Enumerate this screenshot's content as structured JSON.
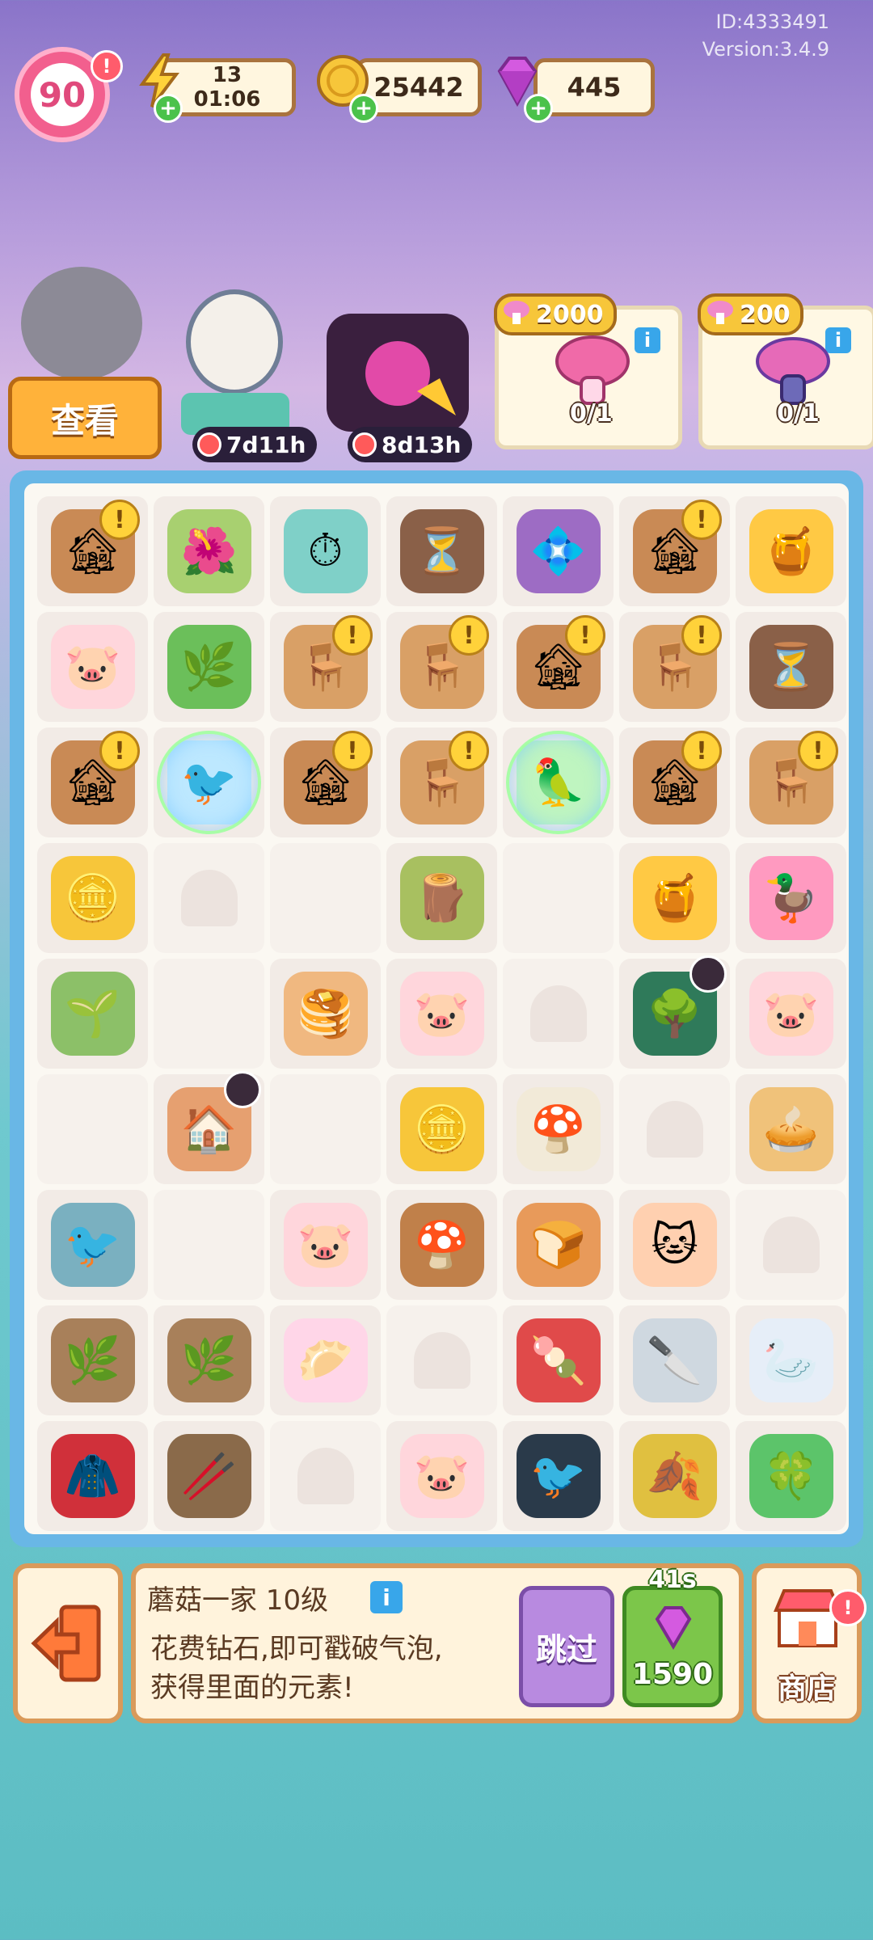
{
  "meta": {
    "player_id": "ID:4333491",
    "version": "Version:3.4.9"
  },
  "player": {
    "level": "90"
  },
  "resources": {
    "energy": {
      "value": "13",
      "timer": "01:06"
    },
    "coins": {
      "value": "25442"
    },
    "gems": {
      "value": "445"
    }
  },
  "characters": {
    "look_button": "查看",
    "timer1": "7d11h",
    "timer2": "8d13h"
  },
  "orders": [
    {
      "price": "2000",
      "progress": "0/1"
    },
    {
      "price": "200",
      "progress": "0/1"
    }
  ],
  "board": {
    "rows": [
      [
        {
          "i": "fireplace",
          "e": "🏚",
          "a": 1
        },
        {
          "i": "pansy-vine",
          "e": "🌺"
        },
        {
          "i": "stopwatch",
          "e": "⏱"
        },
        {
          "i": "hourglass",
          "e": "⏳"
        },
        {
          "i": "gem-frame",
          "e": "💠"
        },
        {
          "i": "fireplace",
          "e": "🏚",
          "a": 1
        },
        {
          "i": "honey-gourd",
          "e": "🍯"
        }
      ],
      [
        {
          "i": "pig-plush",
          "e": "🐷"
        },
        {
          "i": "green-bush",
          "e": "🌿"
        },
        {
          "i": "bear-chair",
          "e": "🪑",
          "a": 1
        },
        {
          "i": "bear-chair",
          "e": "🪑",
          "a": 1
        },
        {
          "i": "fireplace",
          "e": "🏚",
          "a": 1
        },
        {
          "i": "bear-chair",
          "e": "🪑",
          "a": 1
        },
        {
          "i": "hourglass",
          "e": "⏳"
        }
      ],
      [
        {
          "i": "fireplace",
          "e": "🏚",
          "a": 1
        },
        {
          "i": "pigeon-bubble",
          "e": "🐦",
          "b": 1
        },
        {
          "i": "fireplace",
          "e": "🏚",
          "a": 1
        },
        {
          "i": "bear-chair",
          "e": "🪑",
          "a": 1
        },
        {
          "i": "bird-bubble",
          "e": "🦜",
          "b": 1
        },
        {
          "i": "fireplace",
          "e": "🏚",
          "a": 1
        },
        {
          "i": "bear-chair",
          "e": "🪑",
          "a": 1
        }
      ],
      [
        {
          "i": "coin-pile",
          "e": "🪙"
        },
        {
          "i": "empty",
          "p": 1
        },
        {
          "i": "empty"
        },
        {
          "i": "mossy-log",
          "e": "🪵"
        },
        {
          "i": "empty"
        },
        {
          "i": "honey-gourd",
          "e": "🍯"
        },
        {
          "i": "duck-dress",
          "e": "🦆"
        }
      ],
      [
        {
          "i": "vine-branch",
          "e": "🌱"
        },
        {
          "i": "empty"
        },
        {
          "i": "pancake-stack",
          "e": "🥞"
        },
        {
          "i": "pig-plush",
          "e": "🐷"
        },
        {
          "i": "empty",
          "p": 1
        },
        {
          "i": "dark-tree",
          "e": "🌳",
          "l": 1
        },
        {
          "i": "pig-plush",
          "e": "🐷"
        }
      ],
      [
        {
          "i": "empty"
        },
        {
          "i": "gingerbread-house",
          "e": "🏠",
          "l": 1
        },
        {
          "i": "empty"
        },
        {
          "i": "coin",
          "e": "🪙"
        },
        {
          "i": "white-mushroom",
          "e": "🍄"
        },
        {
          "i": "empty",
          "p": 1
        },
        {
          "i": "pie",
          "e": "🥧"
        }
      ],
      [
        {
          "i": "pigeon",
          "e": "🐦"
        },
        {
          "i": "empty"
        },
        {
          "i": "pig-pair",
          "e": "🐷"
        },
        {
          "i": "brown-mushroom",
          "e": "🍄"
        },
        {
          "i": "jam-toast",
          "e": "🍞"
        },
        {
          "i": "pig-cat-group",
          "e": "🐱"
        },
        {
          "i": "empty",
          "p": 1
        }
      ],
      [
        {
          "i": "sparkle-branches",
          "e": "🌿"
        },
        {
          "i": "sparkle-branches",
          "e": "🌿"
        },
        {
          "i": "bun",
          "e": "🥟"
        },
        {
          "i": "empty",
          "p": 1
        },
        {
          "i": "candied-fruit",
          "e": "🍡"
        },
        {
          "i": "pizza-cutter",
          "e": "🔪"
        },
        {
          "i": "swan",
          "e": "🦢"
        }
      ],
      [
        {
          "i": "red-hood",
          "e": "🧥"
        },
        {
          "i": "twig",
          "e": "🥢"
        },
        {
          "i": "empty",
          "p": 1
        },
        {
          "i": "pig-pair",
          "e": "🐷"
        },
        {
          "i": "crow",
          "e": "🐦"
        },
        {
          "i": "autumn-leaf",
          "e": "🍂"
        },
        {
          "i": "clover",
          "e": "🍀"
        }
      ]
    ]
  },
  "info_panel": {
    "title": "蘑菇一家 10级",
    "description_line1": "花费钻石,即可戳破气泡,",
    "description_line2": "获得里面的元素!",
    "skip_label": "跳过",
    "timer": "41s",
    "gem_cost": "1590"
  },
  "shop": {
    "label": "商店"
  },
  "colors": {
    "accent": "#f25f8e",
    "board_border": "#69b7e6",
    "panel_border": "#d99a5a"
  }
}
